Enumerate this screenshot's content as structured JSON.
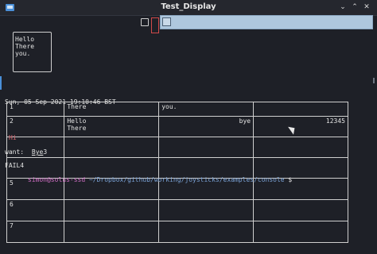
{
  "window": {
    "title": "Test_Display",
    "controls": {
      "minimize": "⌄",
      "maximize": "⌃",
      "close": "✕"
    }
  },
  "hello_box": {
    "text": "Hello\nThere\nyou."
  },
  "timestamp": "Sun, 05 Sep 2021 19:10:46 BST",
  "table": {
    "rows": [
      [
        "1",
        "There",
        "you.",
        ""
      ],
      [
        "2",
        "Hello\nThere",
        "bye",
        "12345"
      ],
      [
        "",
        "",
        "",
        ""
      ],
      [
        "",
        "",
        "",
        ""
      ],
      [
        "5",
        "",
        "",
        ""
      ],
      [
        "6",
        "",
        "",
        ""
      ],
      [
        "7",
        "",
        "",
        ""
      ]
    ]
  },
  "overlay": {
    "hi": "Hi",
    "bye": "Bye",
    "bye_suffix": "3",
    "want": "want:",
    "fail": "FAIL4",
    "user": "simon@solus-ssd",
    "path": " ~/Dropbox/github/working/joysticks/examples/console",
    "prompt": " $"
  },
  "colors": {
    "accent": "#4a8fd8",
    "user": "#d46fc8",
    "path": "#7aa2d6",
    "hi": "#e06c75"
  }
}
